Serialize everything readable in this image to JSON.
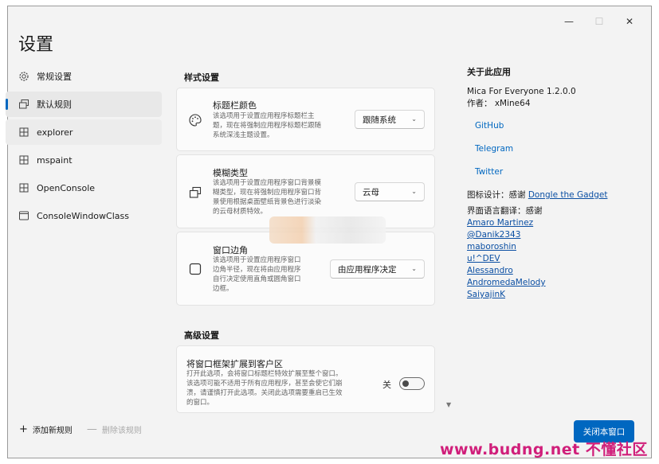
{
  "window": {
    "title": "设置",
    "controls": {
      "minimize": "—",
      "maximize": "☐",
      "close": "✕"
    }
  },
  "sidebar": {
    "items": [
      {
        "label": "常规设置",
        "icon": "gear-icon"
      },
      {
        "label": "默认规则",
        "icon": "window-copy-icon",
        "selected": true
      },
      {
        "label": "explorer",
        "icon": "app-window-icon"
      },
      {
        "label": "mspaint",
        "icon": "app-window-icon"
      },
      {
        "label": "OpenConsole",
        "icon": "app-window-icon"
      },
      {
        "label": "ConsoleWindowClass",
        "icon": "window-icon"
      }
    ],
    "add_rule": "添加新规则",
    "delete_rule": "删除该规则"
  },
  "style_settings": {
    "title": "样式设置",
    "titlebar_color": {
      "title": "标题栏颜色",
      "desc": [
        "该选项用于设置应用程序标题栏主",
        "题，现在将强制应用程序标题栏跟随",
        "系统深浅主题设置。"
      ],
      "value": "跟随系统"
    },
    "backdrop": {
      "title": "模糊类型",
      "desc": [
        "该选项用于设置应用程序窗口背景模",
        "糊类型，现在将强制应用程序窗口背",
        "景使用根据桌面壁纸背景色进行淡染",
        "的云母材质特效。"
      ],
      "value": "云母"
    },
    "corner": {
      "title": "窗口边角",
      "desc": [
        "该选项用于设置应用程序窗口",
        "边角半径，现在将由应用程序",
        "自行决定使用直角或圆角窗口",
        "边框。"
      ],
      "value": "由应用程序决定"
    }
  },
  "advanced_settings": {
    "title": "高级设置",
    "extend_frame": {
      "title": "将窗口框架扩展到客户区",
      "desc": [
        "打开此选项，会将窗口标题栏特效扩展至整个窗口。",
        "该选项可能不适用于所有应用程序，甚至会使它们崩",
        "溃，请谨慎打开此选项。关闭此选项需要重启已生效",
        "的窗口。"
      ],
      "toggle_label": "关",
      "toggle_on": false
    }
  },
  "about": {
    "title": "关于此应用",
    "version": "Mica For Everyone 1.2.0.0",
    "author": "作者： xMine64",
    "links": [
      "GitHub",
      "Telegram",
      "Twitter"
    ],
    "icon_design_prefix": "图标设计：感谢",
    "icon_designer": "Dongle the Gadget",
    "translation_prefix": "界面语言翻译：感谢",
    "translators": [
      "Amaro Martinez",
      "@Danik2343",
      "maboroshin",
      "u!^DEV",
      "Alessandro",
      "AndromedaMelody",
      "SaiyajinK"
    ]
  },
  "close_button": "关闭本窗口",
  "watermark": "www.budng.net 不懂社区",
  "colors": {
    "accent": "#0067c0",
    "window_bg": "#f3f3f3",
    "card_bg": "#fbfbfb",
    "watermark": "#d01e7a"
  }
}
